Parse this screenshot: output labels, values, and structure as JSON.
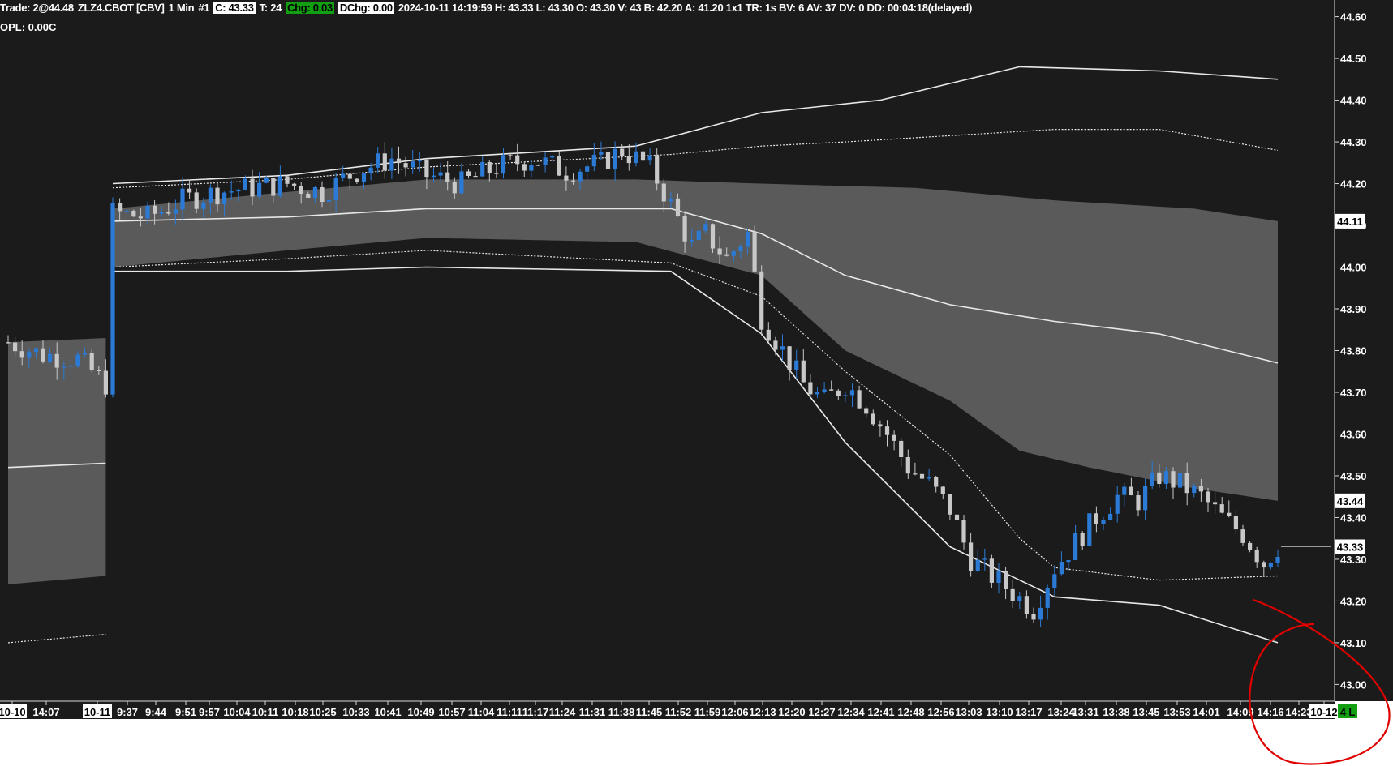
{
  "header": {
    "trade": "Trade: 2@44.48",
    "symbol": "ZLZ4.CBOT [CBV]",
    "interval": "1 Min",
    "chart_no": "#1",
    "close": "C: 43.33",
    "ticks": "T: 24",
    "change": "Chg: 0.03",
    "dchange": "DChg: 0.00",
    "stats": "2024-10-11 14:19:59 H: 43.33 L: 43.30 O: 43.30 V: 43 B: 42.20 A: 41.20 1x1 TR: 1s BV: 6 AV: 37 DV: 0 DD: 00:04:18(delayed)",
    "opl": "OPL: 0.00C"
  },
  "colors": {
    "background": "#1b1b1b",
    "band_fill": "#5a5a5a",
    "band_dark": "#141414",
    "up_candle": "#2b7bd6",
    "down_candle": "#c8c8c8",
    "line": "#e8e8e8",
    "annotation": "#e00000",
    "chg_badge": "#12a012"
  },
  "badges": {
    "level_a": "44.11",
    "level_b": "43.44",
    "level_c": "43.33",
    "bottom_right": "4 L"
  },
  "chart_data": {
    "type": "candlestick",
    "title": "",
    "xlabel": "",
    "ylabel": "",
    "ylim": [
      42.96,
      44.64
    ],
    "y_ticks": [
      43.0,
      43.1,
      43.2,
      43.3,
      43.4,
      43.5,
      43.6,
      43.7,
      43.8,
      43.9,
      44.0,
      44.1,
      44.2,
      44.3,
      44.4,
      44.5,
      44.6
    ],
    "y_tick_labels": [
      "43.00",
      "43.10",
      "43.20",
      "43.30",
      "43.40",
      "43.50",
      "43.60",
      "43.70",
      "43.80",
      "43.90",
      "44.00",
      "44.10",
      "44.20",
      "44.30",
      "44.40",
      "44.50",
      "44.60"
    ],
    "x_tick_labels": [
      "10-10",
      "14:07",
      "10-11",
      "9:37",
      "9:44",
      "9:51",
      "9:57",
      "10:04",
      "10:11",
      "10:18",
      "10:25",
      "10:33",
      "10:41",
      "10:49",
      "10:57",
      "11:04",
      "11:11",
      "11:17",
      "11:24",
      "11:31",
      "11:38",
      "11:45",
      "11:52",
      "11:59",
      "12:06",
      "12:13",
      "12:20",
      "12:27",
      "12:34",
      "12:41",
      "12:48",
      "12:56",
      "13:03",
      "13:10",
      "13:17",
      "13:24",
      "13:31",
      "13:38",
      "13:45",
      "13:53",
      "14:01",
      "14:09",
      "14:16",
      "14:23",
      "10-12"
    ],
    "x_tick_boxed": [
      "10-10",
      "10-11",
      "10-12"
    ],
    "price_path": [
      [
        0,
        43.82
      ],
      [
        5,
        43.79
      ],
      [
        10,
        43.78
      ],
      [
        14,
        43.72
      ],
      [
        15,
        44.13
      ],
      [
        20,
        44.12
      ],
      [
        25,
        44.16
      ],
      [
        30,
        44.18
      ],
      [
        35,
        44.19
      ],
      [
        40,
        44.2
      ],
      [
        45,
        44.18
      ],
      [
        50,
        44.23
      ],
      [
        55,
        44.26
      ],
      [
        60,
        44.22
      ],
      [
        65,
        44.2
      ],
      [
        70,
        44.24
      ],
      [
        75,
        44.26
      ],
      [
        80,
        44.23
      ],
      [
        85,
        44.25
      ],
      [
        88,
        44.28
      ],
      [
        92,
        44.24
      ],
      [
        95,
        44.15
      ],
      [
        98,
        44.05
      ],
      [
        100,
        44.08
      ],
      [
        103,
        44.02
      ],
      [
        106,
        44.08
      ],
      [
        108,
        43.88
      ],
      [
        111,
        43.8
      ],
      [
        114,
        43.72
      ],
      [
        117,
        43.68
      ],
      [
        120,
        43.72
      ],
      [
        123,
        43.67
      ],
      [
        126,
        43.6
      ],
      [
        129,
        43.52
      ],
      [
        132,
        43.48
      ],
      [
        135,
        43.42
      ],
      [
        138,
        43.3
      ],
      [
        141,
        43.26
      ],
      [
        144,
        43.22
      ],
      [
        147,
        43.18
      ],
      [
        150,
        43.28
      ],
      [
        153,
        43.34
      ],
      [
        156,
        43.4
      ],
      [
        159,
        43.45
      ],
      [
        162,
        43.44
      ],
      [
        165,
        43.5
      ],
      [
        168,
        43.48
      ],
      [
        171,
        43.45
      ],
      [
        174,
        43.4
      ],
      [
        177,
        43.36
      ],
      [
        180,
        43.29
      ],
      [
        182,
        43.33
      ]
    ],
    "series": [
      {
        "name": "",
        "style": "solid",
        "values": [
          [
            0,
            43.52
          ],
          [
            14,
            43.53
          ],
          [
            15,
            44.11
          ],
          [
            40,
            44.12
          ],
          [
            60,
            44.14
          ],
          [
            95,
            44.14
          ],
          [
            108,
            44.08
          ],
          [
            120,
            43.98
          ],
          [
            135,
            43.91
          ],
          [
            150,
            43.87
          ],
          [
            165,
            43.84
          ],
          [
            182,
            43.77
          ]
        ]
      },
      {
        "name": "",
        "style": "dotted",
        "values": [
          [
            15,
            44.19
          ],
          [
            40,
            44.21
          ],
          [
            60,
            44.24
          ],
          [
            95,
            44.27
          ],
          [
            108,
            44.29
          ],
          [
            120,
            44.3
          ],
          [
            150,
            44.33
          ],
          [
            165,
            44.33
          ],
          [
            182,
            44.28
          ]
        ]
      },
      {
        "name": "",
        "style": "solid",
        "values": [
          [
            15,
            44.2
          ],
          [
            40,
            44.22
          ],
          [
            60,
            44.26
          ],
          [
            90,
            44.29
          ],
          [
            108,
            44.37
          ],
          [
            125,
            44.4
          ],
          [
            145,
            44.48
          ],
          [
            165,
            44.47
          ],
          [
            182,
            44.45
          ]
        ]
      },
      {
        "name": "",
        "style": "dotted",
        "values": [
          [
            0,
            43.1
          ],
          [
            14,
            43.12
          ],
          [
            15,
            44.0
          ],
          [
            40,
            44.02
          ],
          [
            60,
            44.04
          ],
          [
            95,
            44.01
          ],
          [
            108,
            43.93
          ],
          [
            120,
            43.75
          ],
          [
            135,
            43.55
          ],
          [
            145,
            43.35
          ],
          [
            150,
            43.28
          ],
          [
            165,
            43.25
          ],
          [
            182,
            43.26
          ]
        ]
      },
      {
        "name": "",
        "style": "solid",
        "values": [
          [
            15,
            43.99
          ],
          [
            40,
            43.99
          ],
          [
            60,
            44.0
          ],
          [
            95,
            43.99
          ],
          [
            108,
            43.84
          ],
          [
            120,
            43.58
          ],
          [
            135,
            43.33
          ],
          [
            150,
            43.21
          ],
          [
            165,
            43.19
          ],
          [
            182,
            43.1
          ]
        ]
      }
    ],
    "band": {
      "name": "",
      "upper": [
        [
          0,
          43.82
        ],
        [
          14,
          43.83
        ],
        [
          15,
          44.14
        ],
        [
          40,
          44.18
        ],
        [
          60,
          44.21
        ],
        [
          90,
          44.21
        ],
        [
          108,
          44.2
        ],
        [
          130,
          44.19
        ],
        [
          150,
          44.16
        ],
        [
          170,
          44.14
        ],
        [
          182,
          44.11
        ]
      ],
      "lower": [
        [
          0,
          43.24
        ],
        [
          14,
          43.26
        ],
        [
          15,
          44.0
        ],
        [
          40,
          44.04
        ],
        [
          60,
          44.07
        ],
        [
          90,
          44.06
        ],
        [
          108,
          43.98
        ],
        [
          120,
          43.8
        ],
        [
          135,
          43.68
        ],
        [
          145,
          43.56
        ],
        [
          155,
          43.52
        ],
        [
          170,
          43.47
        ],
        [
          182,
          43.44
        ]
      ]
    },
    "last_price": 43.33
  }
}
